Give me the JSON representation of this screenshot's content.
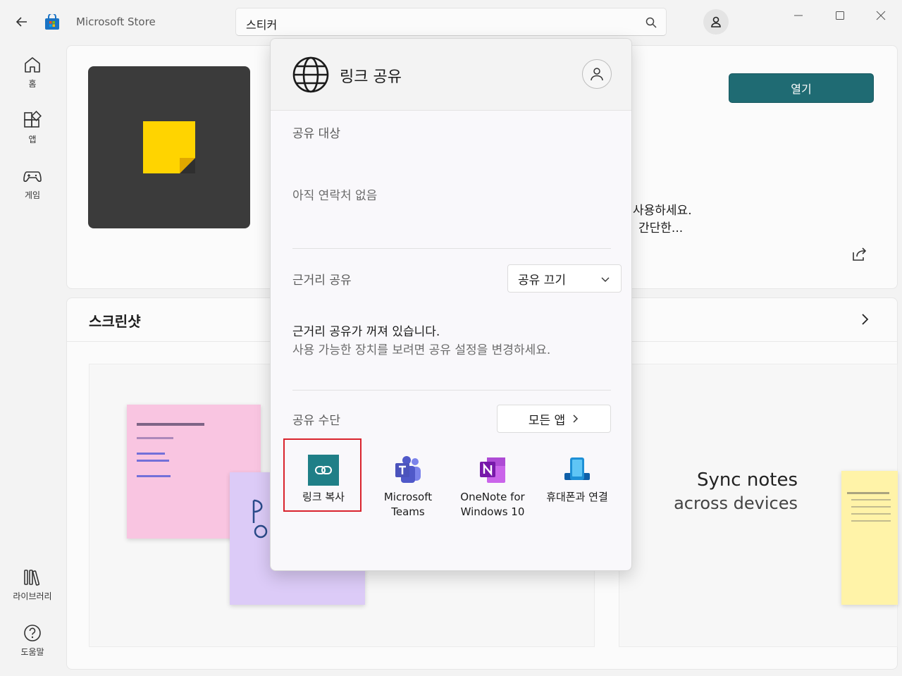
{
  "window": {
    "app_title": "Microsoft Store",
    "search_value": "스티커"
  },
  "sidebar": {
    "items": [
      {
        "label": "홈",
        "icon": "home-icon"
      },
      {
        "label": "앱",
        "icon": "apps-icon"
      },
      {
        "label": "게임",
        "icon": "gamepad-icon"
      },
      {
        "label": "라이브러리",
        "icon": "library-icon"
      },
      {
        "label": "도움말",
        "icon": "help-icon"
      }
    ]
  },
  "hero": {
    "open_label": "열기",
    "description_lines": [
      "사용하세요.",
      "간단한..."
    ]
  },
  "screenshots": {
    "title": "스크린샷",
    "shot2_title": "Sync notes",
    "shot2_subtitle": "across devices"
  },
  "share_dialog": {
    "title": "링크 공유",
    "share_with_label": "공유 대상",
    "no_contacts": "아직 연락처 없음",
    "nearby_label": "근거리 공유",
    "nearby_select_value": "공유 끄기",
    "nearby_off_line1": "근거리 공유가 꺼져 있습니다.",
    "nearby_off_line2": "사용 가능한 장치를 보려면 공유 설정을 변경하세요.",
    "share_via_label": "공유 수단",
    "all_apps_label": "모든 앱",
    "targets": [
      {
        "label": "링크 복사",
        "icon": "copy-link-icon"
      },
      {
        "label": "Microsoft Teams",
        "icon": "teams-icon"
      },
      {
        "label": "OneNote for Windows 10",
        "icon": "onenote-icon"
      },
      {
        "label": "휴대폰과 연결",
        "icon": "phone-link-icon"
      }
    ],
    "highlighted_target": "링크 복사"
  },
  "colors": {
    "accent": "#1f6b73",
    "highlight": "#d9232d"
  }
}
